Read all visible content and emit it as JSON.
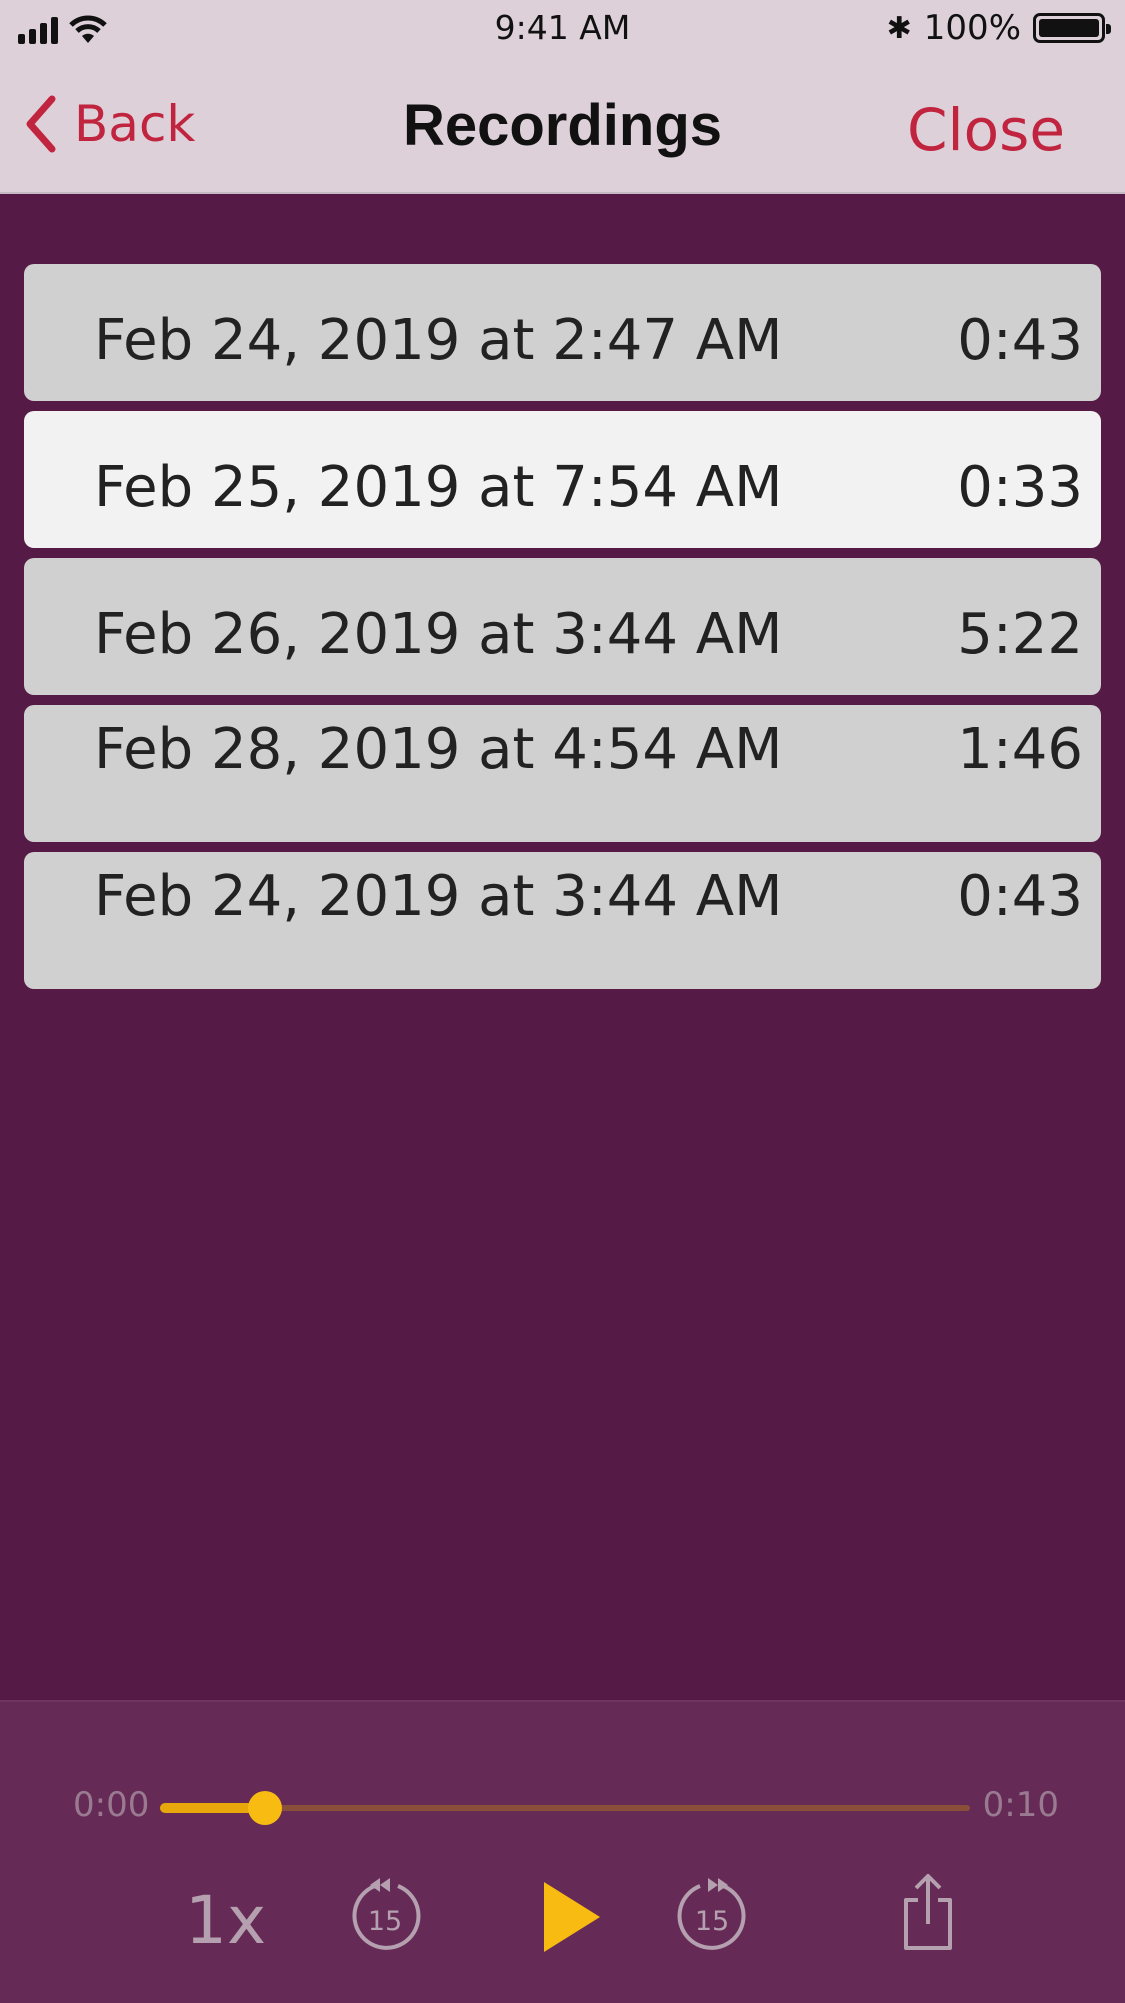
{
  "status_bar": {
    "time": "9:41 AM",
    "battery": "100%",
    "icons": [
      "signal-icon",
      "wifi-icon",
      "bluetooth-icon",
      "battery-icon"
    ]
  },
  "nav": {
    "back_label": "Back",
    "title": "Recordings",
    "close_label": "Close"
  },
  "recordings": [
    {
      "date": "Feb 24, 2019 at 2:47 AM",
      "duration": "0:43"
    },
    {
      "date": "Feb 25, 2019 at 7:54 AM",
      "duration": "0:33",
      "selected": true
    },
    {
      "date": "Feb 26, 2019 at 3:44 AM",
      "duration": "5:22"
    },
    {
      "date": "Feb 28, 2019 at 4:54 AM",
      "duration": "1:46"
    },
    {
      "date": "Feb 24, 2019 at 3:44 AM",
      "duration": "0:43"
    }
  ],
  "player": {
    "time_start": "0:00",
    "time_end": "0:10",
    "progress_fraction": 0.13,
    "speed": "1x",
    "skip_back": "15",
    "skip_forward": "15"
  },
  "colors": {
    "background": "#561a46",
    "accent": "#c0243f",
    "player_accent": "#f7bb12"
  }
}
